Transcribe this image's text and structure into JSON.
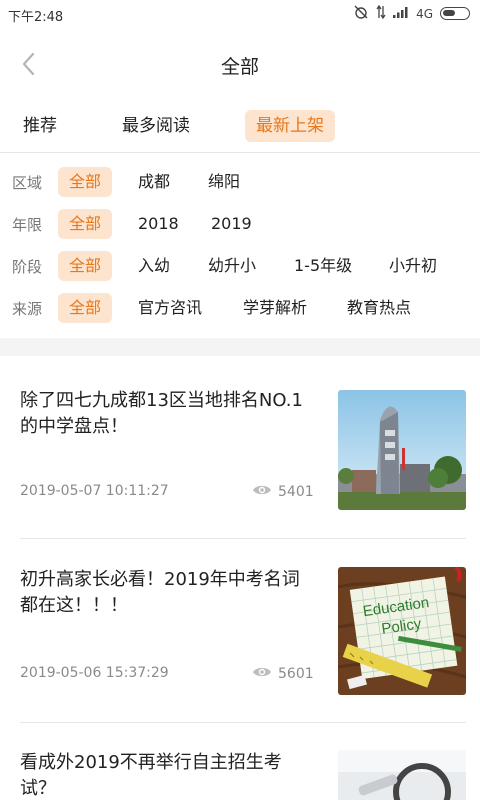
{
  "status_bar": {
    "time": "下午2:48",
    "network": "4G"
  },
  "nav": {
    "title": "全部"
  },
  "tabs": [
    {
      "label": "推荐",
      "active": false
    },
    {
      "label": "最多阅读",
      "active": false
    },
    {
      "label": "最新上架",
      "active": true
    }
  ],
  "filters": [
    {
      "label": "区域",
      "options": [
        "全部",
        "成都",
        "绵阳"
      ],
      "selected": "全部"
    },
    {
      "label": "年限",
      "options": [
        "全部",
        "2018",
        "2019"
      ],
      "selected": "全部"
    },
    {
      "label": "阶段",
      "options": [
        "全部",
        "入幼",
        "幼升小",
        "1-5年级",
        "小升初"
      ],
      "selected": "全部"
    },
    {
      "label": "来源",
      "options": [
        "全部",
        "官方咨讯",
        "学芽解析",
        "教育热点"
      ],
      "selected": "全部"
    }
  ],
  "articles": [
    {
      "title": "除了四七九成都13区当地排名NO.1的中学盘点！",
      "date": "2019-05-07 10:11:27",
      "views": "5401"
    },
    {
      "title": "初升高家长必看！2019年中考名词都在这！！！",
      "date": "2019-05-06 15:37:29",
      "views": "5601",
      "image_text": [
        "Education",
        "Policy"
      ]
    },
    {
      "title": "看成外2019不再举行自主招生考试？",
      "date": "",
      "views": ""
    }
  ],
  "colors": {
    "accent": "#e8781a",
    "accent_bg": "#fde4cf"
  }
}
